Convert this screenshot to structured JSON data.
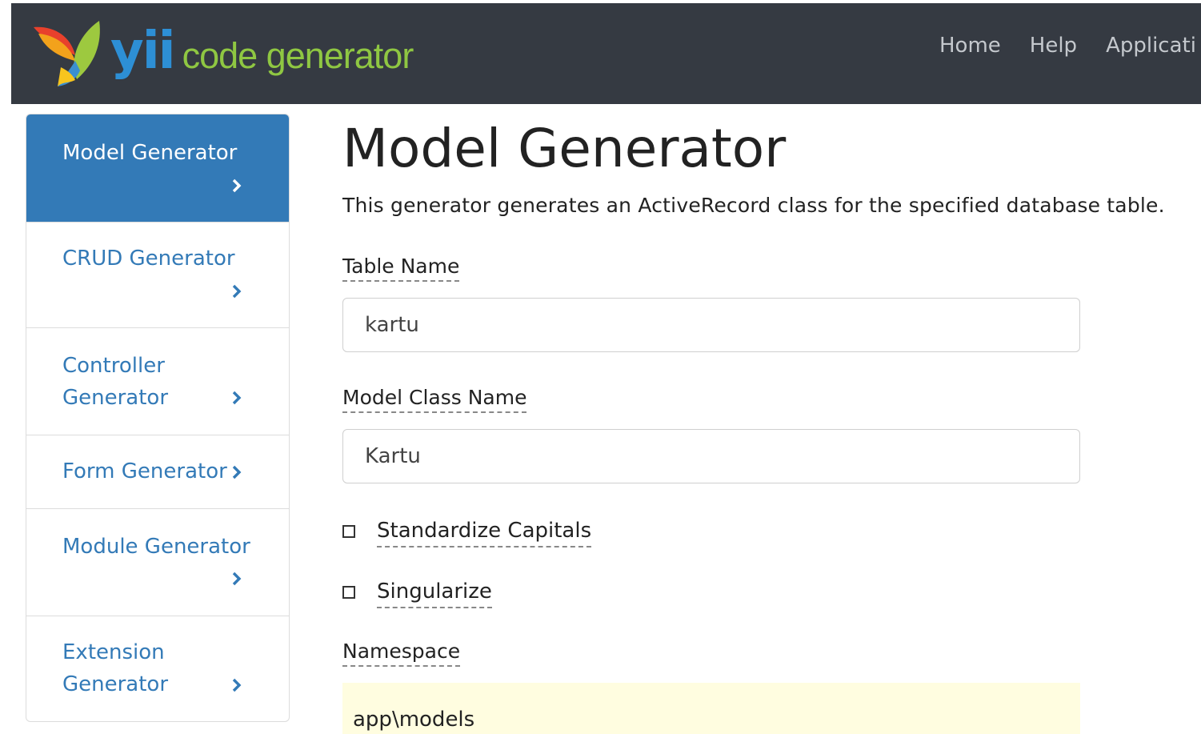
{
  "brand": {
    "logo_text": "yii",
    "logo_subtitle": "code generator"
  },
  "nav": {
    "links": [
      "Home",
      "Help",
      "Applicati"
    ]
  },
  "sidebar": {
    "items": [
      {
        "label": "Model Generator",
        "active": true
      },
      {
        "label": "CRUD Generator",
        "active": false
      },
      {
        "label": "Controller Generator",
        "active": false
      },
      {
        "label": "Form Generator",
        "active": false
      },
      {
        "label": "Module Generator",
        "active": false
      },
      {
        "label": "Extension Generator",
        "active": false
      }
    ],
    "chevron_icon": "chevron-right-icon"
  },
  "main": {
    "title": "Model Generator",
    "description": "This generator generates an ActiveRecord class for the specified database table.",
    "fields": {
      "table_name": {
        "label": "Table Name",
        "value": "kartu"
      },
      "model_class": {
        "label": "Model Class Name",
        "value": "Kartu"
      },
      "standardize_capitals": {
        "label": "Standardize Capitals",
        "checked": false
      },
      "singularize": {
        "label": "Singularize",
        "checked": false
      },
      "namespace": {
        "label": "Namespace",
        "value": "app\\models"
      }
    }
  },
  "colors": {
    "navbar_bg": "#353a42",
    "accent": "#337ab7",
    "logo_blue": "#2d8fd5",
    "logo_green": "#8fc742",
    "highlight_bg": "#fffde0"
  }
}
